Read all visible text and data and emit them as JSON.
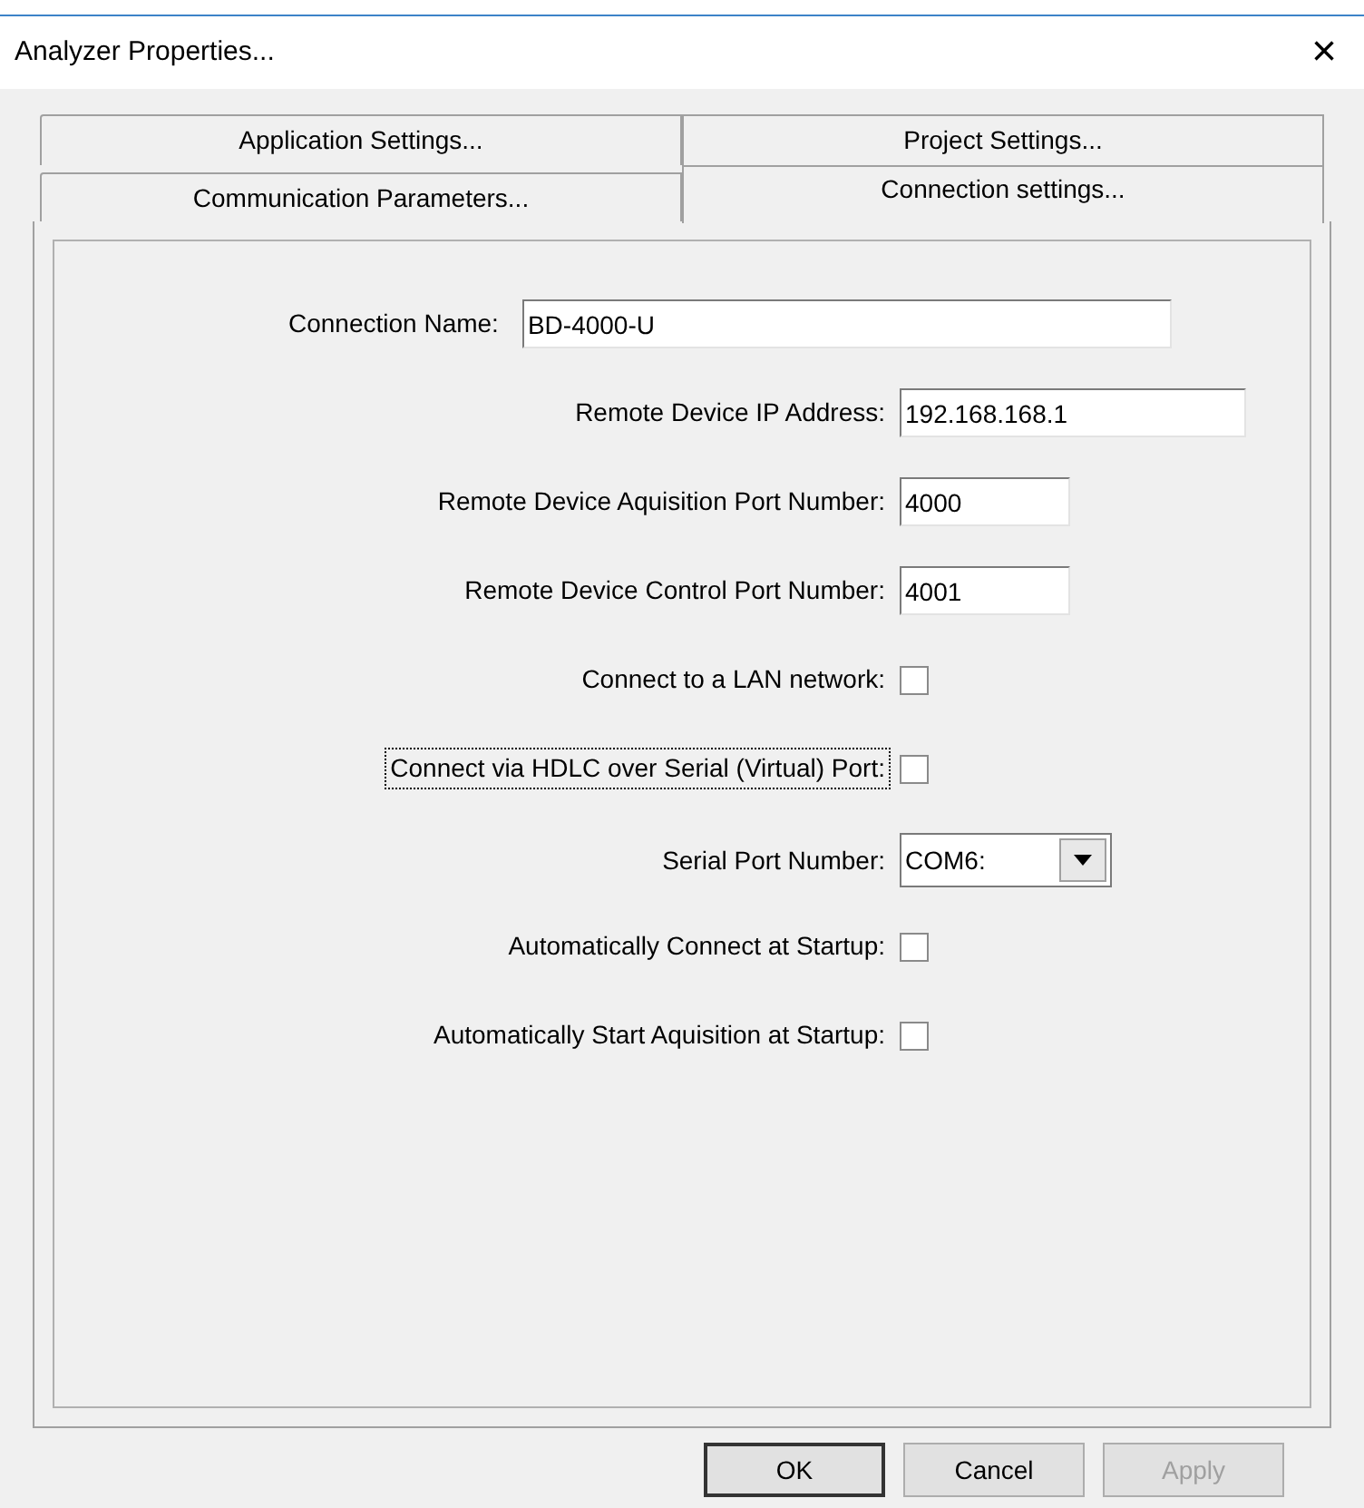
{
  "window": {
    "title": "Analyzer Properties...",
    "close": "×"
  },
  "tabs": [
    [
      {
        "label": "Application Settings...",
        "selected": false
      },
      {
        "label": "Project Settings...",
        "selected": false
      }
    ],
    [
      {
        "label": "Communication Parameters...",
        "selected": false
      },
      {
        "label": "Connection settings...",
        "selected": true
      }
    ]
  ],
  "fields": [
    {
      "kind": "wide_text",
      "label": "Connection Name:",
      "value": "BD-4000-U",
      "focused": false
    },
    {
      "kind": "text",
      "label": "Remote Device IP Address:",
      "value": "192.168.168.1",
      "focused": false
    },
    {
      "kind": "short_text",
      "label": "Remote Device Aquisition Port Number:",
      "value": "4000",
      "focused": false
    },
    {
      "kind": "short_text",
      "label": "Remote Device Control Port Number:",
      "value": "4001",
      "focused": false
    },
    {
      "kind": "checkbox",
      "label": "Connect to a LAN network:",
      "checked": false,
      "focused": false
    },
    {
      "kind": "checkbox",
      "label": "Connect via HDLC over Serial (Virtual) Port:",
      "checked": false,
      "focused": true
    },
    {
      "kind": "select",
      "label": "Serial Port Number:",
      "value": "COM6:",
      "focused": false
    },
    {
      "kind": "checkbox",
      "label": "Automatically Connect at Startup:",
      "checked": false,
      "focused": false
    },
    {
      "kind": "checkbox",
      "label": "Automatically Start Aquisition at Startup:",
      "checked": false,
      "focused": false
    }
  ],
  "buttons": [
    {
      "label": "OK",
      "disabled": false
    },
    {
      "label": "Cancel",
      "disabled": false
    },
    {
      "label": "Apply",
      "disabled": true
    }
  ]
}
